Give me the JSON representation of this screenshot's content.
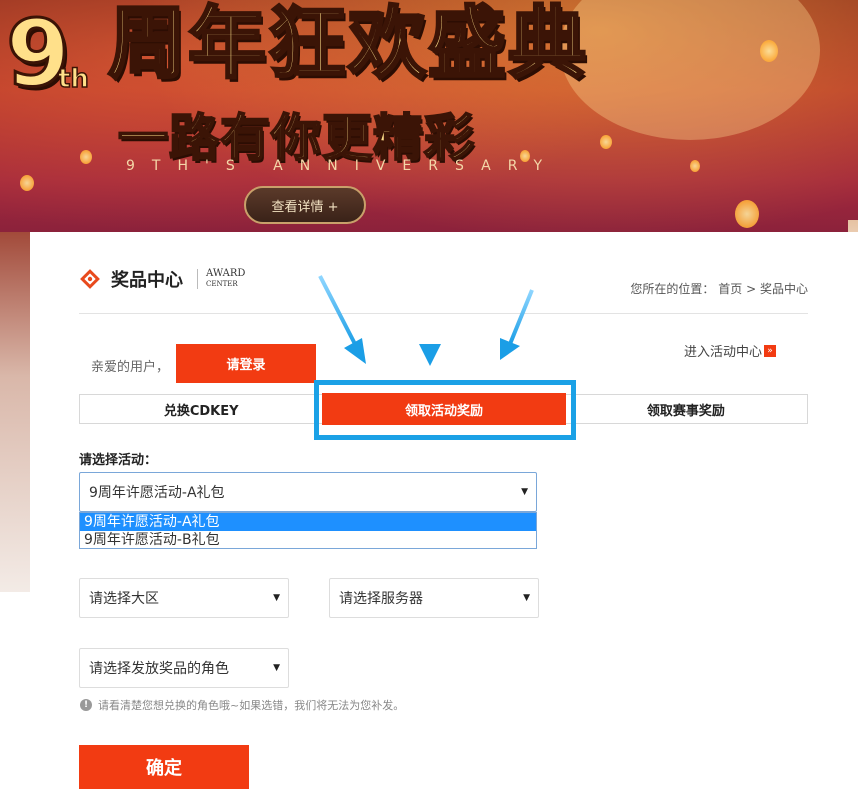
{
  "banner": {
    "logo_number": "9",
    "logo_suffix": "th",
    "title": "周年狂欢盛典",
    "subtitle": "一路有你更精彩",
    "english": "9TH'S ANNIVERSARY",
    "detail_button": "查看详情 +"
  },
  "section": {
    "title": "奖品中心",
    "en_line1": "AWARD",
    "en_line2": "CENTER"
  },
  "breadcrumb": {
    "prefix": "您所在的位置：",
    "home": "首页",
    "separator": ">",
    "current": "奖品中心"
  },
  "user": {
    "greeting": "亲爱的用户，",
    "login_button": "请登录"
  },
  "activity_center_link": "进入活动中心",
  "tabs": [
    {
      "label": "兑换CDKEY",
      "active": false
    },
    {
      "label": "领取活动奖励",
      "active": true
    },
    {
      "label": "领取赛事奖励",
      "active": false
    }
  ],
  "form": {
    "activity_label": "请选择活动：",
    "activity_selected": "9周年许愿活动-A礼包",
    "activity_options": [
      "9周年许愿活动-A礼包",
      "9周年许愿活动-B礼包"
    ],
    "region_placeholder": "请选择大区",
    "server_placeholder": "请选择服务器",
    "role_placeholder": "请选择发放奖品的角色",
    "hint": "请看清楚您想兑换的角色哦~如果选错，我们将无法为您补发。",
    "confirm_button": "确定"
  },
  "colors": {
    "accent": "#f23b12",
    "highlight_border": "#1ba1e6",
    "arrow": "#29a8ec"
  }
}
